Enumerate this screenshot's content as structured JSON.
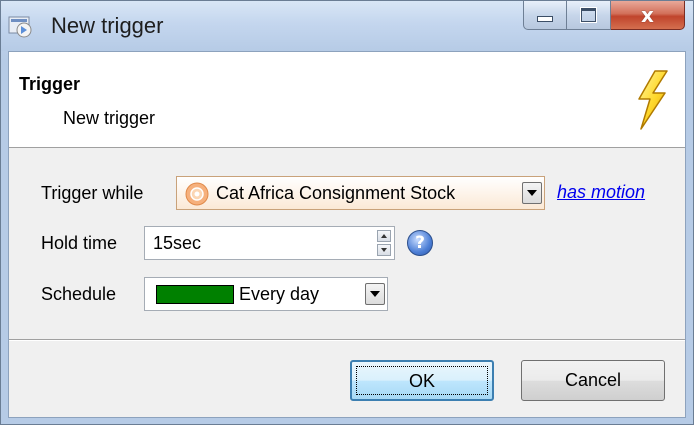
{
  "window": {
    "title": "New trigger",
    "icons": {
      "app": "trigger-app-icon",
      "minimize": "minimize-icon",
      "maximize": "maximize-icon",
      "close": "close-icon",
      "close_glyph": "x"
    }
  },
  "header": {
    "title": "Trigger",
    "subtitle": "New trigger",
    "icon": "lightning-bolt-icon"
  },
  "form": {
    "trigger_while": {
      "label": "Trigger while",
      "selected_camera": "Cat Africa Consignment Stock",
      "camera_icon": "camera-icon",
      "condition_link": "has motion"
    },
    "hold_time": {
      "label": "Hold time",
      "value": "15sec",
      "help_icon": "question-icon",
      "help_glyph": "?"
    },
    "schedule": {
      "label": "Schedule",
      "value": "Every day",
      "swatch_color": "#008000"
    }
  },
  "buttons": {
    "ok": "OK",
    "cancel": "Cancel"
  },
  "colors": {
    "link": "#0000ee",
    "ok_border": "#3c7fb1",
    "close_button": "#c0442c"
  }
}
